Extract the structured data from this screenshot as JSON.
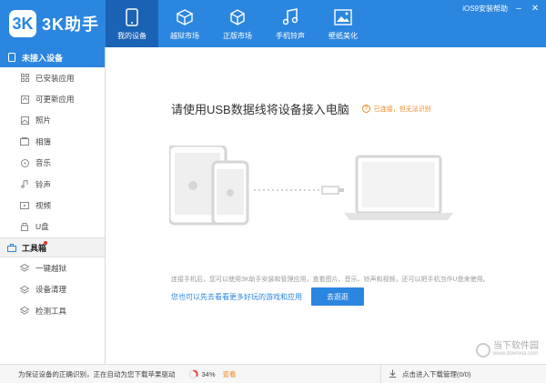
{
  "app": {
    "logo_text": "3K助手",
    "logo_badge": "3K"
  },
  "nav": [
    {
      "label": "我的设备",
      "icon": "phone-icon",
      "active": true
    },
    {
      "label": "越狱市场",
      "icon": "box-icon",
      "active": false
    },
    {
      "label": "正版市场",
      "icon": "package-icon",
      "active": false
    },
    {
      "label": "手机铃声",
      "icon": "music-note-icon",
      "active": false
    },
    {
      "label": "壁纸美化",
      "icon": "picture-icon",
      "active": false
    }
  ],
  "top_right": {
    "link": "iOS9安装帮助"
  },
  "sidebar": {
    "device_section": "未接入设备",
    "device_items": [
      {
        "label": "已安装应用",
        "icon": "apps-icon"
      },
      {
        "label": "可更新应用",
        "icon": "refresh-icon"
      },
      {
        "label": "照片",
        "icon": "photo-icon"
      },
      {
        "label": "相簿",
        "icon": "album-icon"
      },
      {
        "label": "音乐",
        "icon": "music-icon"
      },
      {
        "label": "铃声",
        "icon": "bell-icon"
      },
      {
        "label": "视频",
        "icon": "video-icon"
      },
      {
        "label": "U盘",
        "icon": "usb-drive-icon"
      }
    ],
    "tools_section": "工具箱",
    "tools_items": [
      {
        "label": "一键越狱",
        "icon": "layers-icon"
      },
      {
        "label": "设备清理",
        "icon": "broom-icon"
      },
      {
        "label": "检测工具",
        "icon": "stack-icon"
      }
    ]
  },
  "main": {
    "title": "请使用USB数据线将设备接入电脑",
    "warning": "已连接，但无法识别",
    "hint": "连接手机后，您可以使用3K助手安装和管理应用，查看图片、音乐、铃声和视频，还可以把手机当作U盘来使用。",
    "link": "您也可以先去看看更多好玩的游戏和应用",
    "button": "去逛逛"
  },
  "status": {
    "message": "为保证设备的正确识别，正在自动为您下载苹果驱动",
    "progress": 34,
    "progress_text": "34%",
    "view_link": "查看",
    "download_manager": "点击进入下载管理(0/0)"
  },
  "watermark": {
    "big": "当下软件园",
    "small": "www.downxia.com"
  },
  "colors": {
    "accent": "#2b86e0",
    "nav_active": "#1a62b4",
    "warning": "#f08a24"
  }
}
